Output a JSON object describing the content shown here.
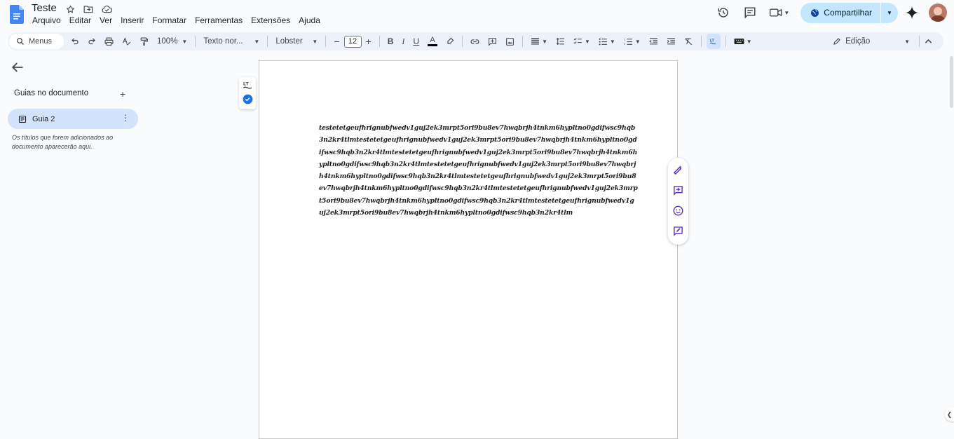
{
  "doc": {
    "title": "Teste"
  },
  "menu": [
    "Arquivo",
    "Editar",
    "Ver",
    "Inserir",
    "Formatar",
    "Ferramentas",
    "Extensões",
    "Ajuda"
  ],
  "header": {
    "share_label": "Compartilhar"
  },
  "toolbar": {
    "search_label": "Menus",
    "zoom": "100%",
    "style": "Texto nor...",
    "font": "Lobster",
    "font_size": "12",
    "mode_label": "Edição"
  },
  "sidebar": {
    "title": "Guias no documento",
    "tab_label": "Guia 2",
    "hint": "Os títulos que forem adicionados ao documento aparecerão aqui."
  },
  "body": {
    "text": "testetetgeufhrignubfwedv1guj2ek3mrpt5ori9bu8ev7hwqbrjh4tnkm6hypltno0gdifwsc9hqb3n2kr4tlmtestetetgeufhrignubfwedv1guj2ek3mrpt5ori9bu8ev7hwqbrjh4tnkm6hypltno0gdifwsc9hqb3n2kr4tlmtestetetgeufhrignubfwedv1guj2ek3mrpt5ori9bu8ev7hwqbrjh4tnkm6hypltno0gdifwsc9hqb3n2kr4tlmtestetetgeufhrignubfwedv1guj2ek3mrpt5ori9bu8ev7hwqbrjh4tnkm6hypltno0gdifwsc9hqb3n2kr4tlmtestetetgeufhrignubfwedv1guj2ek3mrpt5ori9bu8ev7hwqbrjh4tnkm6hypltno0gdifwsc9hqb3n2kr4tlmtestetetgeufhrignubfwedv1guj2ek3mrpt5ori9bu8ev7hwqbrjh4tnkm6hypltno0gdifwsc9hqb3n2kr4tlmtestetetgeufhrignubfwedv1guj2ek3mrpt5ori9bu8ev7hwqbrjh4tnkm6hypltno0gdifwsc9hqb3n2kr4tlm"
  },
  "icons": {
    "logo": "google-docs-icon",
    "star": "star-icon",
    "move": "folder-move-icon",
    "cloud": "cloud-saved-icon",
    "history": "history-icon",
    "comments": "comments-icon",
    "meet": "video-camera-icon",
    "gemini": "gemini-sparkle-icon"
  },
  "colors": {
    "accent": "#0b57d0",
    "share_bg": "#c2e7ff",
    "toolbar_bg": "#edf2fa",
    "tab_selected": "#d3e3fd",
    "float_icons": "#5b2fbf"
  }
}
